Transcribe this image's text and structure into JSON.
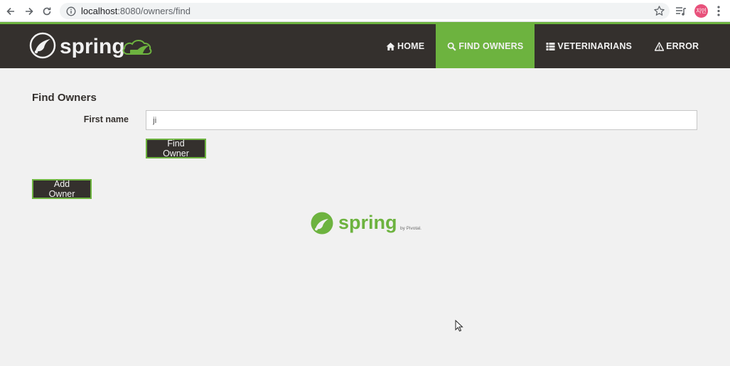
{
  "browser": {
    "url_host": "localhost",
    "url_path": ":8080/owners/find",
    "avatar_text": "지민"
  },
  "navbar": {
    "brand_text": "spring",
    "items": [
      {
        "label": "HOME",
        "icon": "home-icon",
        "active": false
      },
      {
        "label": "FIND OWNERS",
        "icon": "search-icon",
        "active": true
      },
      {
        "label": "VETERINARIANS",
        "icon": "list-icon",
        "active": false
      },
      {
        "label": "ERROR",
        "icon": "warning-icon",
        "active": false
      }
    ]
  },
  "main": {
    "title": "Find Owners",
    "first_name_label": "First name",
    "first_name_value": "ji",
    "find_button": "Find Owner",
    "add_button": "Add Owner"
  },
  "footer": {
    "logo_text": "spring",
    "by_text": "by Pivotal."
  },
  "colors": {
    "accent": "#6db33f",
    "navbar_bg": "#34302d",
    "page_bg": "#f1f1f1"
  }
}
